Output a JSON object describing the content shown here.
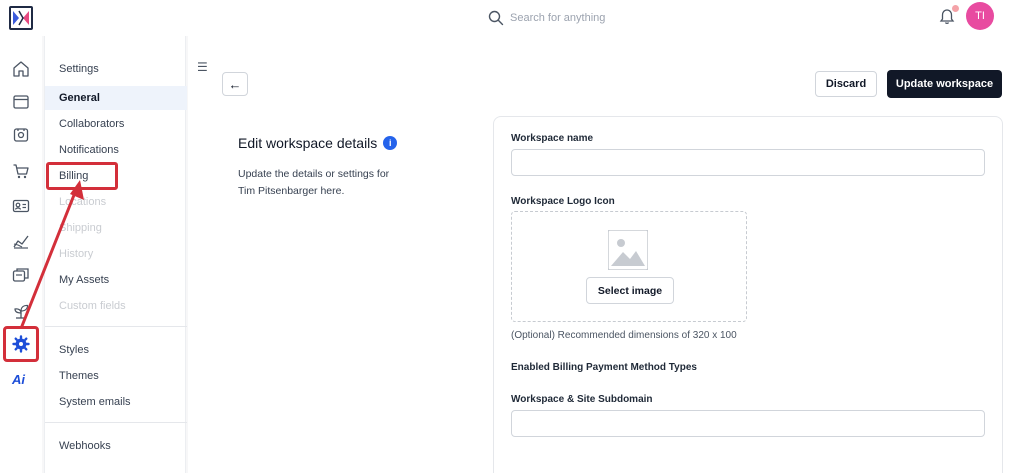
{
  "header": {
    "search": {
      "placeholder": "Search for anything"
    },
    "avatar_initials": "TI",
    "colors": {
      "avatar": "#e84ba0",
      "notification": "#f4a3a8"
    }
  },
  "rail": {
    "items": [
      {
        "icon": "home-icon"
      },
      {
        "icon": "window-icon"
      },
      {
        "icon": "box-icon"
      },
      {
        "icon": "cart-icon"
      },
      {
        "icon": "contact-card-icon"
      },
      {
        "icon": "analytics-icon"
      },
      {
        "icon": "files-icon"
      },
      {
        "icon": "plant-icon"
      },
      {
        "icon": "gear-icon",
        "active": true
      }
    ],
    "ai_label": "Ai",
    "highlight_color": "#d32f3a"
  },
  "settings_nav": {
    "title": "Settings",
    "items": [
      {
        "label": "General",
        "state": "active"
      },
      {
        "label": "Collaborators",
        "state": "normal"
      },
      {
        "label": "Notifications",
        "state": "normal"
      },
      {
        "label": "Billing",
        "state": "highlighted"
      },
      {
        "label": "Locations",
        "state": "disabled"
      },
      {
        "label": "Shipping",
        "state": "disabled"
      },
      {
        "label": "History",
        "state": "disabled"
      },
      {
        "label": "My Assets",
        "state": "normal"
      },
      {
        "label": "Custom fields",
        "state": "disabled"
      }
    ],
    "group2": [
      {
        "label": "Styles"
      },
      {
        "label": "Themes"
      },
      {
        "label": "System emails"
      }
    ],
    "group3": [
      {
        "label": "Webhooks"
      }
    ]
  },
  "toolbar": {
    "back_label": "←",
    "discard_label": "Discard",
    "update_label": "Update workspace"
  },
  "section": {
    "title": "Edit workspace details",
    "description": "Update the details or settings for Tim Pitsenbarger here."
  },
  "form": {
    "workspace_name_label": "Workspace name",
    "workspace_name_value": "",
    "logo_label": "Workspace Logo Icon",
    "select_image_label": "Select image",
    "logo_hint": "(Optional) Recommended dimensions of 320 x 100",
    "billing_methods_label": "Enabled Billing Payment Method Types",
    "subdomain_label": "Workspace & Site Subdomain",
    "subdomain_value": ""
  }
}
